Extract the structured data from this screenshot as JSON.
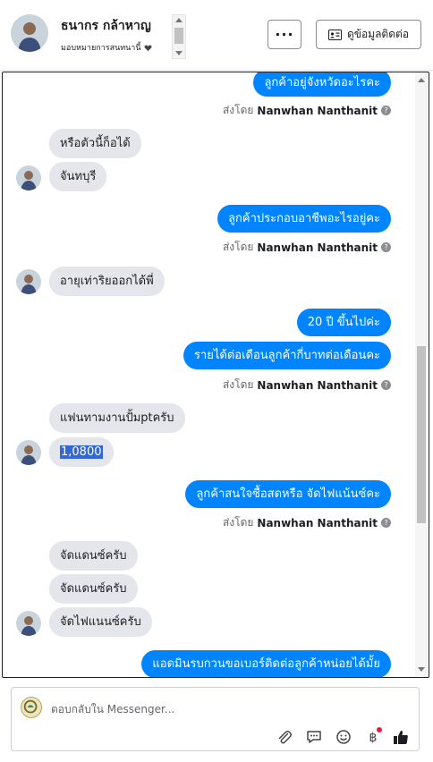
{
  "header": {
    "name": "ธนากร กล้าหาญ",
    "assign_label": "มอบหมายการสนทนานี้",
    "more_label": "···",
    "contact_label": "ดูข้อมูลติดต่อ"
  },
  "chat": {
    "sender_prefix": "ส่งโดย",
    "sender_name": "Nanwhan Nanthanit",
    "messages": {
      "m1": "ลูกค้าอยู่จังหวัดอะไรคะ",
      "m2": "หรือตัวนี้ก็อได้",
      "m3": "จันทบุรี",
      "m4": "ลูกค้าประกอบอาชีพอะไรอยู่คะ",
      "m5": "อายุเท่าริยออกได้พี่",
      "m6": "20 ปี ขึ้นไปค่ะ",
      "m7": "รายได้ต่อเดือนลูกค้ากี่บาทต่อเดือนคะ",
      "m8": "แฟนทามงานปั้มptครับ",
      "m9": "1,0800",
      "m10": "ลูกค้าสนใจซื้อสดหรือ จัดไฟแน้นซ์คะ",
      "m11": "จัดแดนซ์ครับ",
      "m12": "จัดแดนซ์ครับ",
      "m13": "จัดไฟแนนซ์ครับ",
      "m14": "แอดมินรบกวนขอเบอร์ติดต่อลูกค้าหน่อยได้มั้ย"
    }
  },
  "composer": {
    "placeholder": "ตอบกลับใน Messenger..."
  },
  "colors": {
    "outgoing": "#0084ff",
    "incoming": "#e4e6eb",
    "notification_dot": "#e41e3f"
  },
  "icons": [
    "more-icon",
    "contact-card-icon",
    "chevron-down-icon",
    "help-icon",
    "attachment-icon",
    "message-icon",
    "emoji-icon",
    "baht-icon",
    "thumbs-up-icon"
  ]
}
